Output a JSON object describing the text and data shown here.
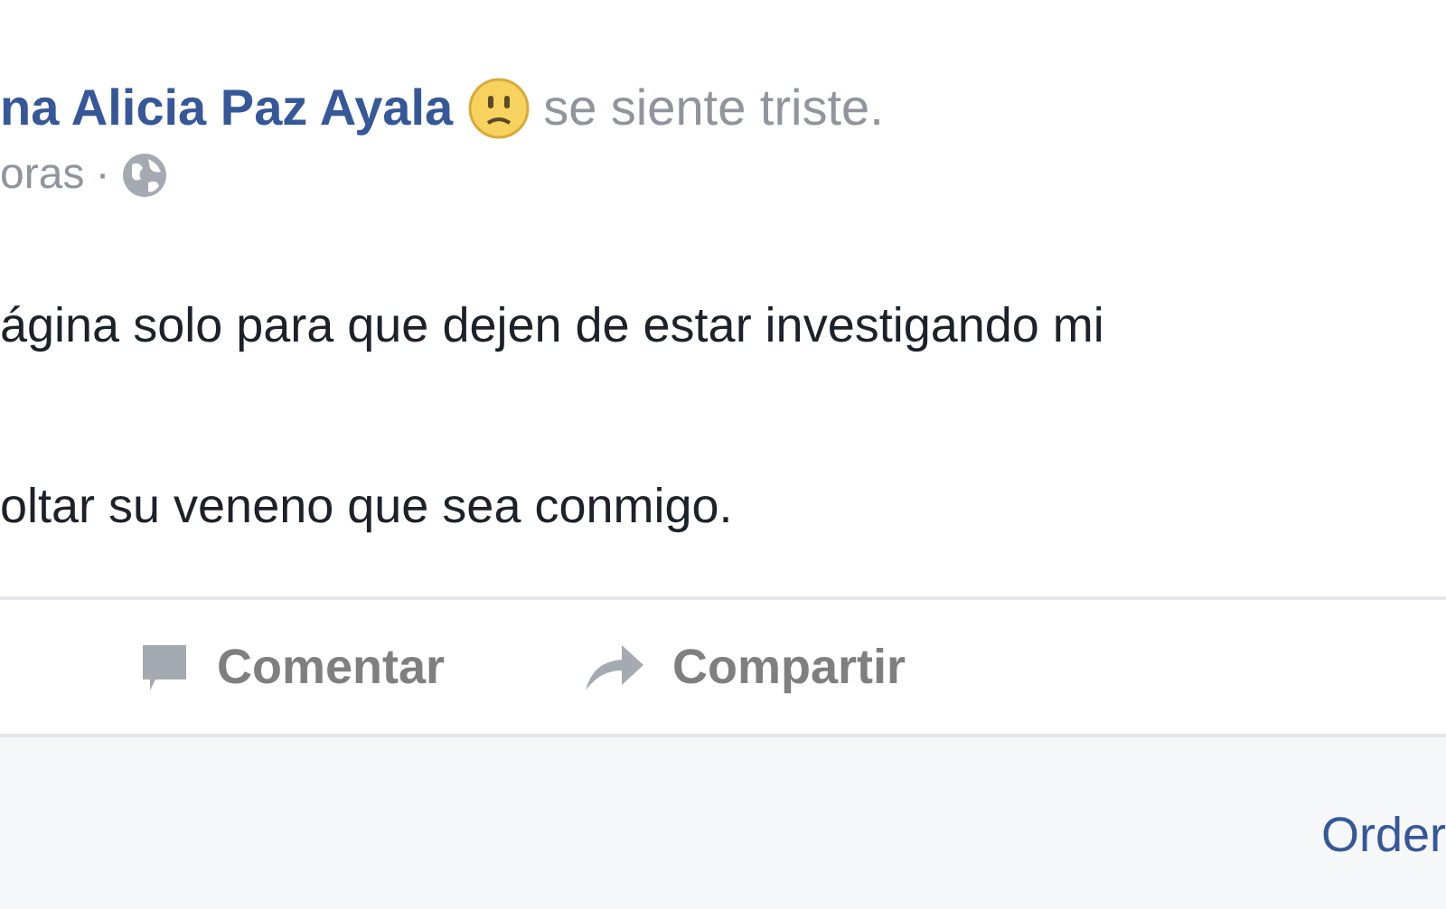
{
  "post": {
    "author": "na Alicia Paz Ayala",
    "feeling": "se siente triste.",
    "time": "oras",
    "separator": "·",
    "paragraphs": [
      "ágina solo para que dejen de estar investigando mi",
      "oltar su veneno que sea conmigo."
    ]
  },
  "actions": [
    {
      "label": "Comentar",
      "kind": "comment"
    },
    {
      "label": "Compartir",
      "kind": "share"
    }
  ],
  "comments_bar": {
    "sort_label": "Order"
  }
}
